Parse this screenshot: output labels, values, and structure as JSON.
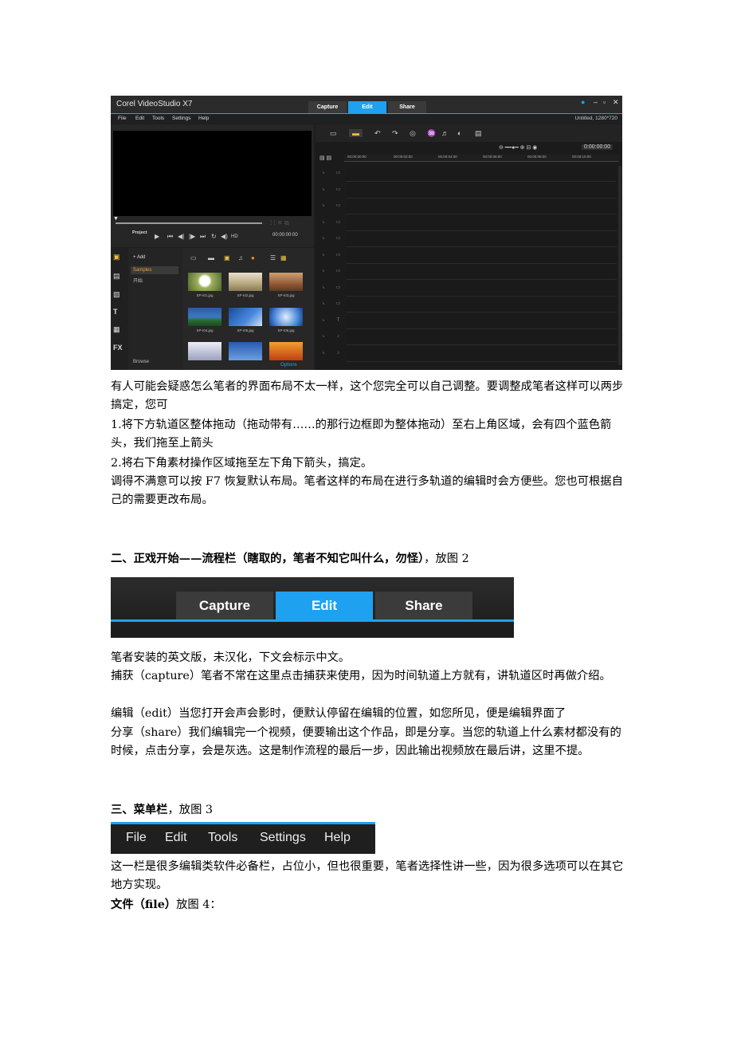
{
  "screenshot1": {
    "app_title": "Corel VideoStudio X7",
    "tabs": [
      "Capture",
      "Edit",
      "Share"
    ],
    "menu": [
      "File",
      "Edit",
      "Tools",
      "Settings",
      "Help"
    ],
    "status": "Untitled, 1280*720",
    "project_label": "Project",
    "playback_timecode": "00:00:00:00",
    "hd_label": "HD",
    "add_label": "Add",
    "samples_label": "Samples",
    "samples_sub": "开始",
    "browse_label": "Browse",
    "options_label": "Options",
    "thumbnails": [
      "SP-I01.jpg",
      "SP-I02.jpg",
      "SP-I03.jpg",
      "SP-I04.jpg",
      "SP-I05.jpg",
      "SP-I06.jpg"
    ],
    "timeline_timecode": "0:00:00:00",
    "ruler": [
      "00:00:00:00",
      "00:00:02:00",
      "00:00:04:00",
      "00:00:06:00",
      "00:00:08:00",
      "00:00:10:00"
    ],
    "accent": "#1ea1f0"
  },
  "text": {
    "p1": "有人可能会疑惑怎么笔者的界面布局不太一样，这个您完全可以自己调整。要调整成笔者这样可以两步搞定，您可",
    "p2": "1.将下方轨道区整体拖动（拖动带有……的那行边框即为整体拖动）至右上角区域，会有四个蓝色箭头，我们拖至上箭头",
    "p3": "2.将右下角素材操作区域拖至左下角下箭头，搞定。",
    "p4": "调得不满意可以按 F7 恢复默认布局。笔者这样的布局在进行多轨道的编辑时会方便些。您也可根据自己的需要更改布局。",
    "h2_bold": "二、正戏开始——流程栏（瞎取的，笔者不知它叫什么，勿怪）",
    "h2_rest": "，放图 2",
    "p5": "笔者安装的英文版，未汉化，下文会标示中文。",
    "p6": "捕获（capture）笔者不常在这里点击捕获来使用，因为时间轨道上方就有，讲轨道区时再做介绍。",
    "p7": "编辑（edit）当您打开会声会影时，便默认停留在编辑的位置，如您所见，便是编辑界面了",
    "p8": "分享（share）我们编辑完一个视频，便要输出这个作品，即是分享。当您的轨道上什么素材都没有的时候，点击分享，会是灰选。这是制作流程的最后一步，因此输出视频放在最后讲，这里不提。",
    "h3_bold": "三、菜单栏",
    "h3_rest": "，放图 3",
    "p9": "这一栏是很多编辑类软件必备栏，占位小，但也很重要，笔者选择性讲一些，因为很多选项可以在其它地方实现。",
    "h4_bold": "文件（file）",
    "h4_rest": "放图 4："
  },
  "screenshot2": {
    "tabs": [
      "Capture",
      "Edit",
      "Share"
    ],
    "active": "Edit"
  },
  "screenshot3": {
    "menu": [
      "File",
      "Edit",
      "Tools",
      "Settings",
      "Help"
    ]
  }
}
